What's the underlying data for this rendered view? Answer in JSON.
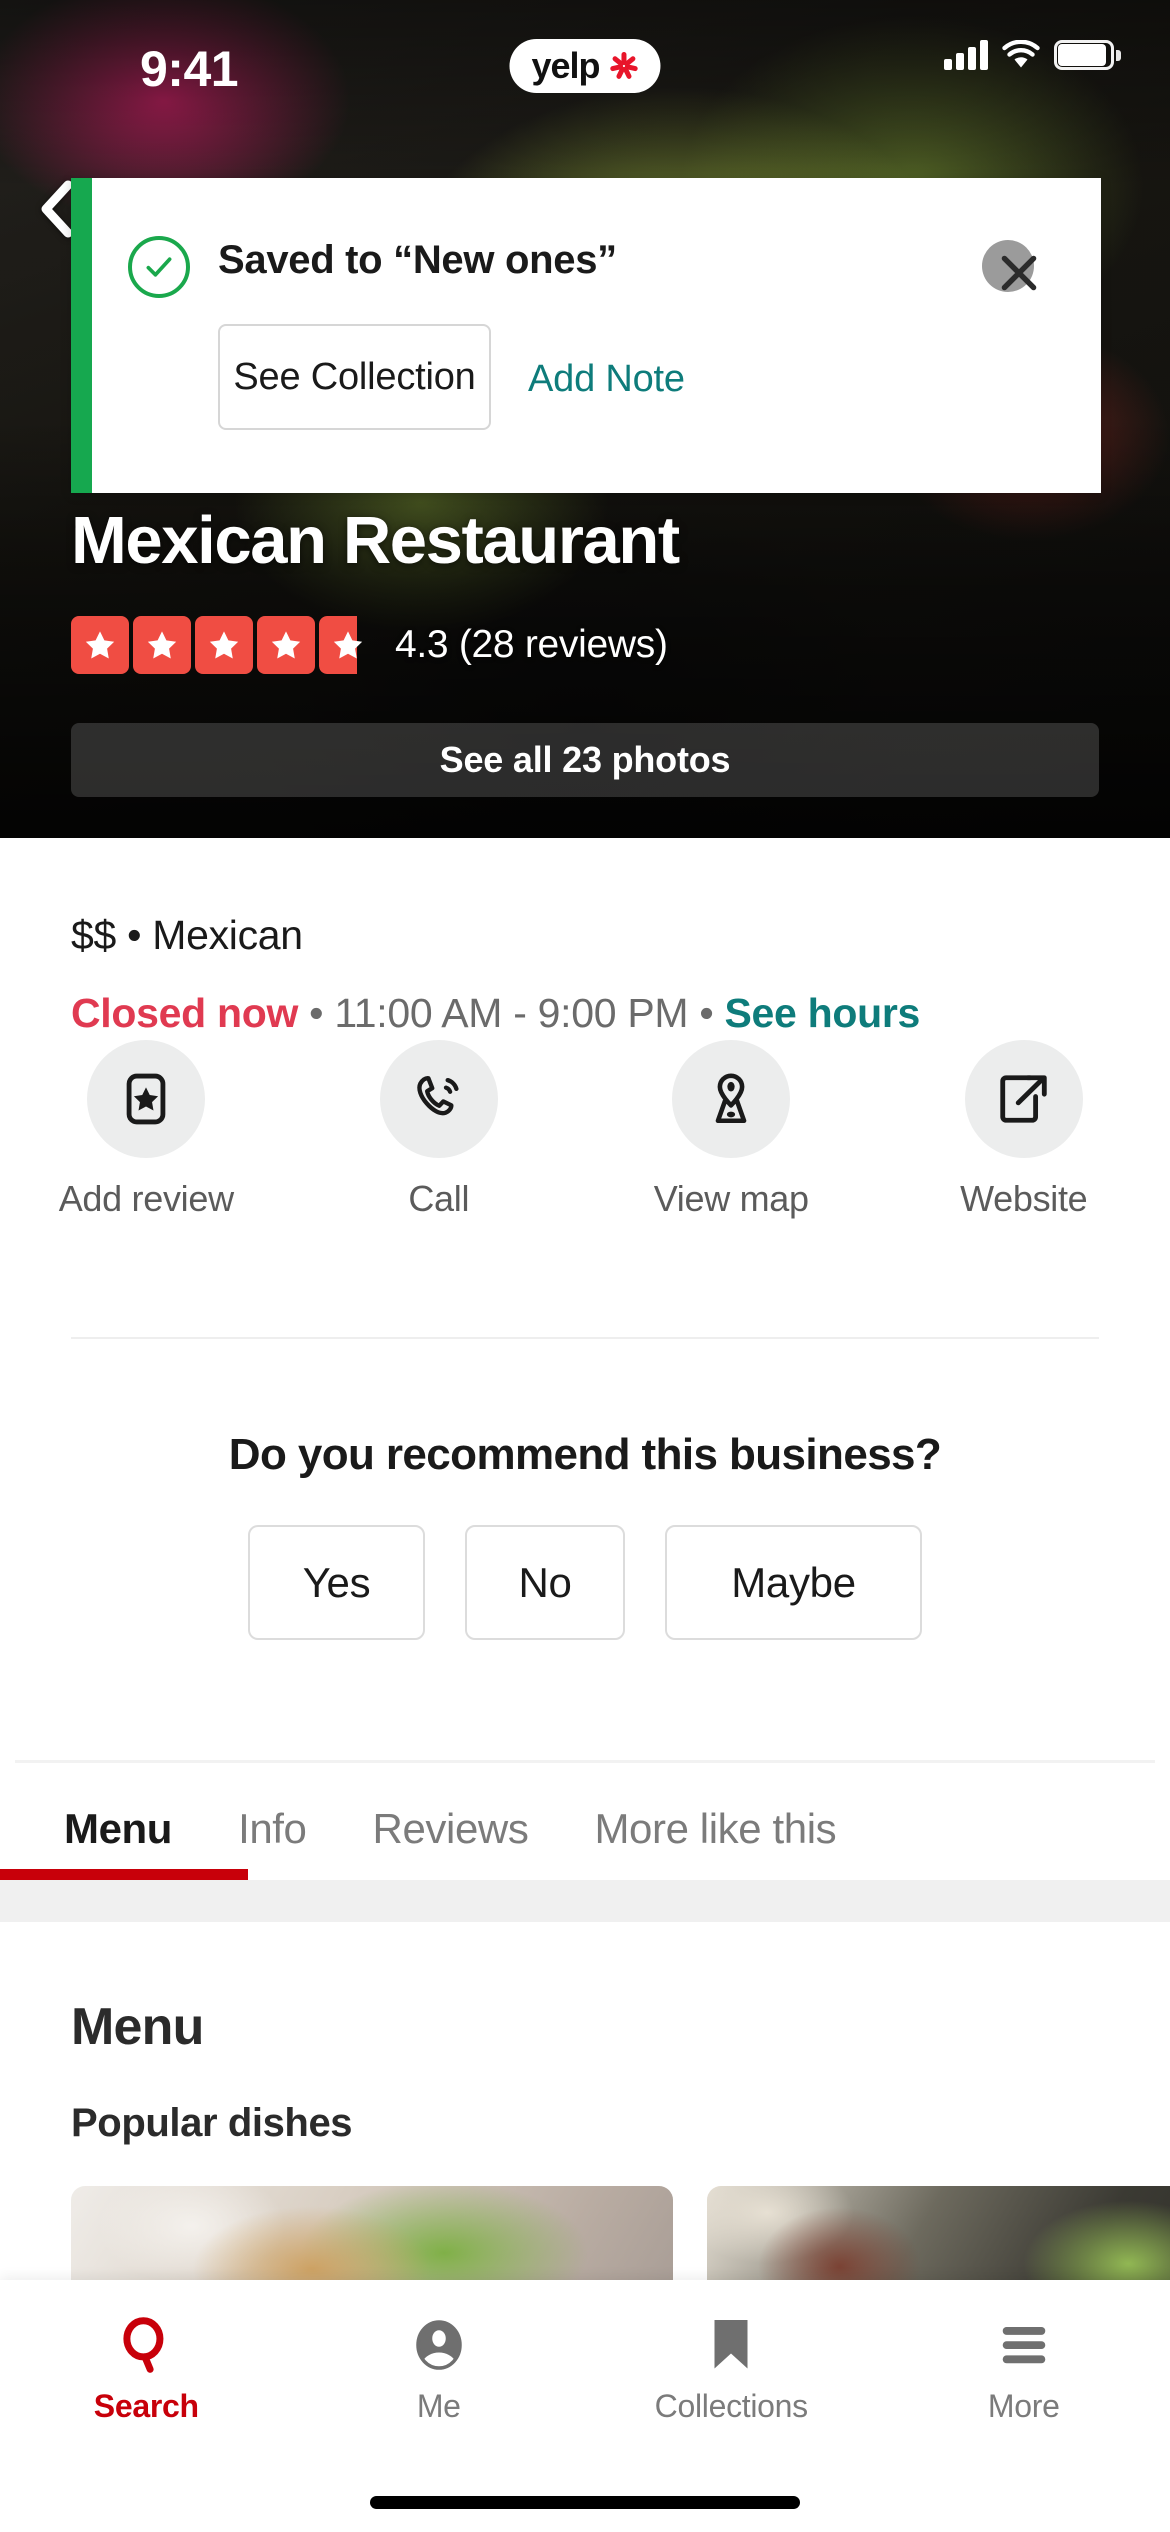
{
  "status_bar": {
    "time": "9:41",
    "brand": "yelp",
    "icons": [
      "cellular-signal-icon",
      "wifi-icon",
      "battery-icon"
    ]
  },
  "hero": {
    "back_icon": "chevron-left-icon",
    "business_name": "Mexican Restaurant",
    "rating_value": 4.3,
    "rating_text": "4.3 (28 reviews)",
    "review_count": 28,
    "stars_total": 5,
    "see_photos_label": "See all 23 photos",
    "photo_count": 23,
    "star_color": "#f04d43"
  },
  "toast": {
    "title": "Saved to “New ones”",
    "collection_name": "New ones",
    "check_icon": "check-circle-icon",
    "close_icon": "close-x-icon",
    "see_collection_label": "See Collection",
    "add_note_label": "Add Note",
    "accent_color": "#16a84f",
    "link_color": "#0e7c7b"
  },
  "info": {
    "price_category": "$$ • Mexican",
    "price_range": "$$",
    "category": "Mexican",
    "status": "Closed now",
    "status_color": "#e03a51",
    "separator": " • ",
    "hours": "11:00 AM - 9:00 PM",
    "see_hours_label": "See hours"
  },
  "actions": [
    {
      "label": "Add review",
      "icon": "add-review-star-icon"
    },
    {
      "label": "Call",
      "icon": "phone-call-icon"
    },
    {
      "label": "View map",
      "icon": "map-pin-icon"
    },
    {
      "label": "Website",
      "icon": "external-link-icon"
    }
  ],
  "recommend": {
    "question": "Do you recommend this business?",
    "options": [
      "Yes",
      "No",
      "Maybe"
    ]
  },
  "tabs": {
    "active_index": 0,
    "active_color": "#c8000a",
    "items": [
      {
        "label": "Menu"
      },
      {
        "label": "Info"
      },
      {
        "label": "Reviews"
      },
      {
        "label": "More like this"
      }
    ]
  },
  "menu": {
    "heading": "Menu",
    "subheading": "Popular dishes",
    "dishes": [
      {
        "name": "dish-photo-1"
      },
      {
        "name": "dish-photo-2"
      }
    ]
  },
  "bottom_nav": {
    "active_index": 0,
    "active_color": "#c8000a",
    "items": [
      {
        "label": "Search",
        "icon": "search-icon"
      },
      {
        "label": "Me",
        "icon": "person-circle-icon"
      },
      {
        "label": "Collections",
        "icon": "bookmark-icon"
      },
      {
        "label": "More",
        "icon": "hamburger-menu-icon"
      }
    ]
  }
}
